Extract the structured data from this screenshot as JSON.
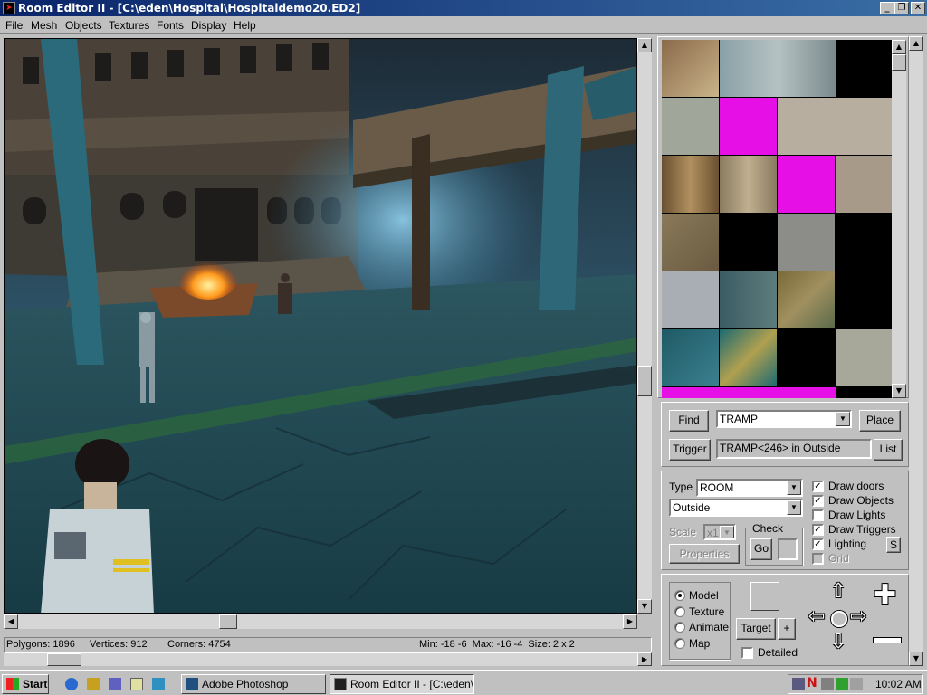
{
  "window": {
    "title": "Room Editor II - [C:\\eden\\Hospital\\Hospitaldemo20.ED2]"
  },
  "menu": [
    "File",
    "Mesh",
    "Objects",
    "Textures",
    "Fonts",
    "Display",
    "Help"
  ],
  "status": {
    "polygons": "Polygons: 1896",
    "vertices": "Vertices: 912",
    "corners": "Corners: 4754",
    "minmax": "Min: -18 -6  Max: -16 -4  Size: 2 x 2"
  },
  "find_panel": {
    "find": "Find",
    "search_value": "TRAMP",
    "place": "Place",
    "trigger": "Trigger",
    "trigger_value": "TRAMP<246> in Outside",
    "list": "List"
  },
  "options": {
    "type_label": "Type",
    "type_value": "ROOM",
    "room_value": "Outside",
    "scale_label": "Scale",
    "scale_value": "x1",
    "check_label": "Check",
    "go": "Go",
    "properties": "Properties",
    "checks": [
      {
        "label": "Draw doors",
        "checked": true
      },
      {
        "label": "Draw Objects",
        "checked": true
      },
      {
        "label": "Draw Lights",
        "checked": false
      },
      {
        "label": "Draw Triggers",
        "checked": true
      },
      {
        "label": "Lighting",
        "checked": true
      },
      {
        "label": "Grid",
        "checked": false
      }
    ],
    "s_button": "S"
  },
  "mode": {
    "radios": [
      {
        "label": "Model",
        "selected": true
      },
      {
        "label": "Texture",
        "selected": false
      },
      {
        "label": "Animate",
        "selected": false
      },
      {
        "label": "Map",
        "selected": false
      }
    ],
    "target": "Target",
    "plus": "+",
    "detailed": "Detailed"
  },
  "taskbar": {
    "start": "Start",
    "tasks": [
      "Adobe Photoshop",
      "Room Editor II - [C:\\eden\\..."
    ],
    "clock": "10:02 AM"
  },
  "colors": {
    "titlebar": "#0a246a",
    "magenta": "#e60fe6"
  }
}
